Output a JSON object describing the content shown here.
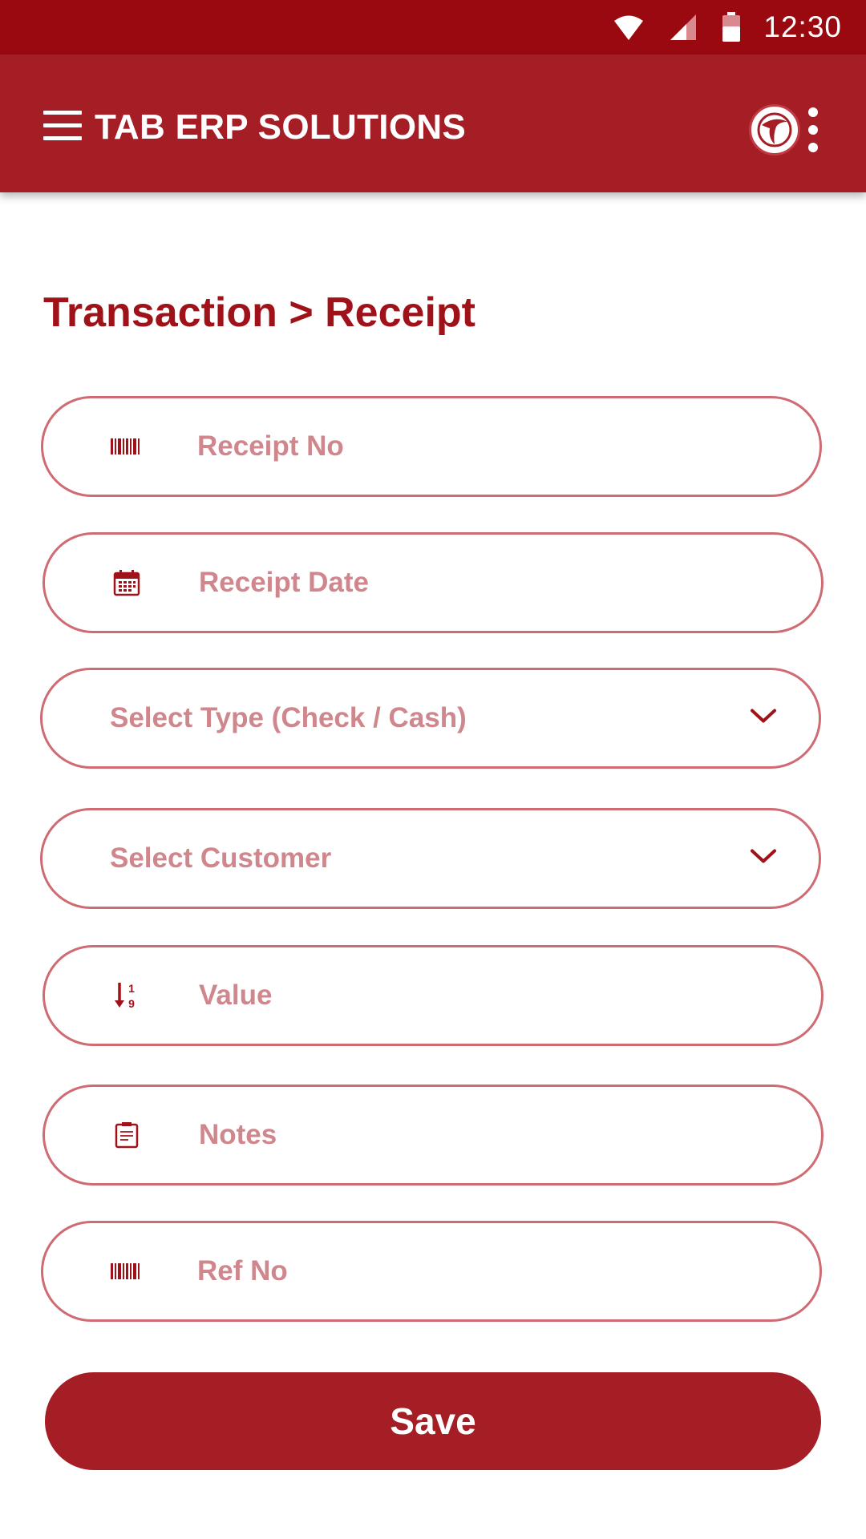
{
  "status_bar": {
    "time": "12:30",
    "icons": [
      "wifi-icon",
      "cell-signal-icon",
      "battery-icon"
    ]
  },
  "app_bar": {
    "title": "TAB ERP SOLUTIONS",
    "menu_icon": "hamburger-menu-icon",
    "logo_icon": "company-logo",
    "overflow_icon": "more-vertical-icon"
  },
  "page": {
    "breadcrumb": "Transaction > Receipt"
  },
  "form": {
    "receipt_no": {
      "placeholder": "Receipt No",
      "value": "",
      "icon": "barcode-icon"
    },
    "receipt_date": {
      "placeholder": "Receipt Date",
      "value": "",
      "icon": "calendar-icon"
    },
    "type_select": {
      "text": "Select Type (Check / Cash)",
      "icon": "chevron-down-icon"
    },
    "customer_select": {
      "text": "Select Customer",
      "icon": "chevron-down-icon"
    },
    "value": {
      "placeholder": "Value",
      "value": "",
      "icon": "numeric-sort-icon"
    },
    "notes": {
      "placeholder": "Notes",
      "value": "",
      "icon": "notepad-icon"
    },
    "ref_no": {
      "placeholder": "Ref No",
      "value": "",
      "icon": "barcode-icon"
    },
    "save_label": "Save"
  },
  "colors": {
    "status_bar": "#9b0910",
    "app_bar": "#a51d25",
    "accent": "#a01219",
    "field_border": "#cf6b72",
    "placeholder": "#cf868c"
  }
}
